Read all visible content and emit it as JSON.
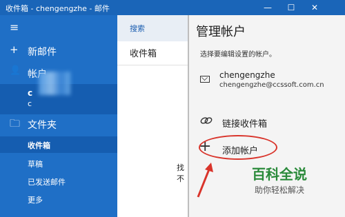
{
  "titlebar": {
    "title": "收件箱 - chengengzhe - 邮件",
    "minimize": "—",
    "maximize": "☐",
    "close": "✕"
  },
  "sidebar": {
    "hamburger": "≡",
    "new_mail": {
      "icon": "+",
      "label": "新邮件"
    },
    "accounts": {
      "icon": "👤",
      "label": "帐户"
    },
    "account_blurred": {
      "name": "c",
      "mail": "c"
    },
    "folders": {
      "icon": "🗀",
      "label": "文件夹"
    },
    "folder_items": [
      "收件箱",
      "草稿",
      "已发送邮件",
      "更多"
    ]
  },
  "middle": {
    "search": "搜索",
    "inbox": "收件箱",
    "found_text": "找不"
  },
  "panel": {
    "title": "管理帐户",
    "subtitle": "选择要编辑设置的帐户。",
    "account": {
      "name": "chengengzhe",
      "email": "chengengzhe@ccssoft.com.cn"
    },
    "link_inboxes": "链接收件箱",
    "add_account": "添加帐户"
  },
  "watermark": {
    "main": "百科全说",
    "sub": "助你轻松解决"
  },
  "colors": {
    "sidebar": "#1f6fc6",
    "titlebar": "#1a65b8",
    "highlight": "#d9342b"
  }
}
